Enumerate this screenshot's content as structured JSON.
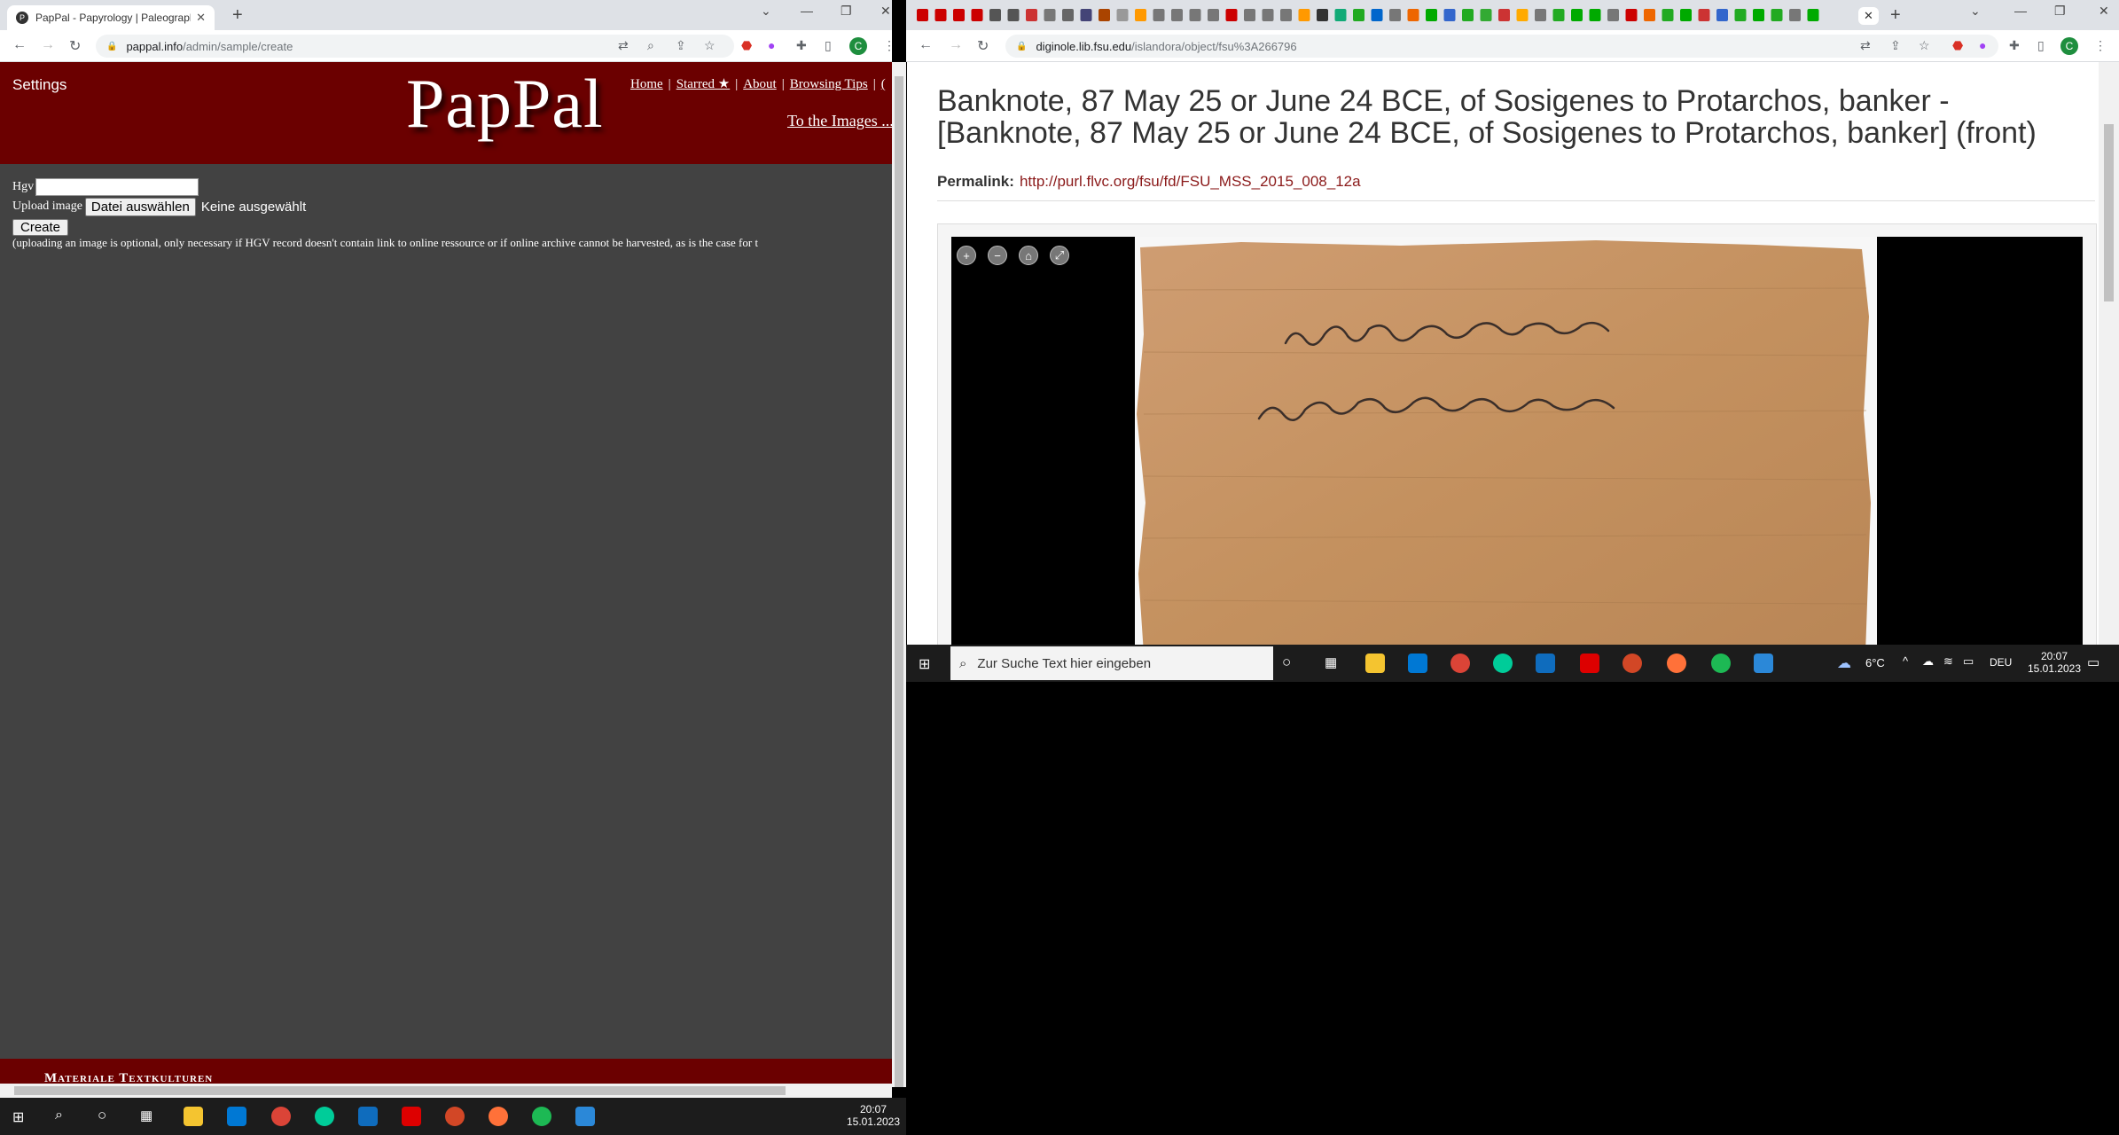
{
  "left_browser": {
    "tab_title": "PapPal - Papyrology | Paleograph",
    "favicon": "pappal-favicon",
    "url_host": "pappal.info",
    "url_path": "/admin/sample/create",
    "profile_letter": "C"
  },
  "left_page": {
    "settings": "Settings",
    "logo": "PapPal",
    "nav": [
      {
        "label": "Home"
      },
      {
        "label": "Starred ★"
      },
      {
        "label": "About"
      },
      {
        "label": "Browsing Tips"
      },
      {
        "label": "("
      }
    ],
    "to_images": "To the Images ...",
    "form": {
      "hgv_label": "Hgv",
      "hgv_value": "",
      "upload_label": "Upload image",
      "file_button": "Datei auswählen",
      "no_file": "Keine ausgewählt",
      "create_button": "Create",
      "note": "(uploading an image is optional, only necessary if HGV record doesn't contain link to online ressource or if online archive cannot be harvested, as is the case for t"
    },
    "footer": "Materiale Textkulturen"
  },
  "right_browser": {
    "url_host": "diginole.lib.fsu.edu",
    "url_path": "/islandora/object/fsu%3A266796",
    "profile_letter": "C"
  },
  "right_page": {
    "title": "Banknote, 87 May 25 or June 24 BCE, of Sosigenes to Protarchos, banker - [Banknote, 87 May 25 or June 24 BCE, of Sosigenes to Protarchos, banker] (front)",
    "permalink_label": "Permalink:",
    "permalink_url": "http://purl.flvc.org/fsu/fd/FSU_MSS_2015_008_12a",
    "viewer_controls": [
      "zoom-in-icon",
      "zoom-out-icon",
      "home-icon",
      "fullscreen-icon"
    ]
  },
  "right_taskbar": {
    "search_placeholder": "Zur Suche Text hier eingeben",
    "weather": "6°C",
    "language": "DEU",
    "time": "20:07",
    "date": "15.01.2023"
  },
  "left_taskbar": {
    "time": "20:07",
    "date": "15.01.2023"
  },
  "colors": {
    "pappal_red": "#6b0000",
    "page_gray": "#424242",
    "link_red": "#8b1a1a",
    "papyrus": "#c9976a"
  }
}
